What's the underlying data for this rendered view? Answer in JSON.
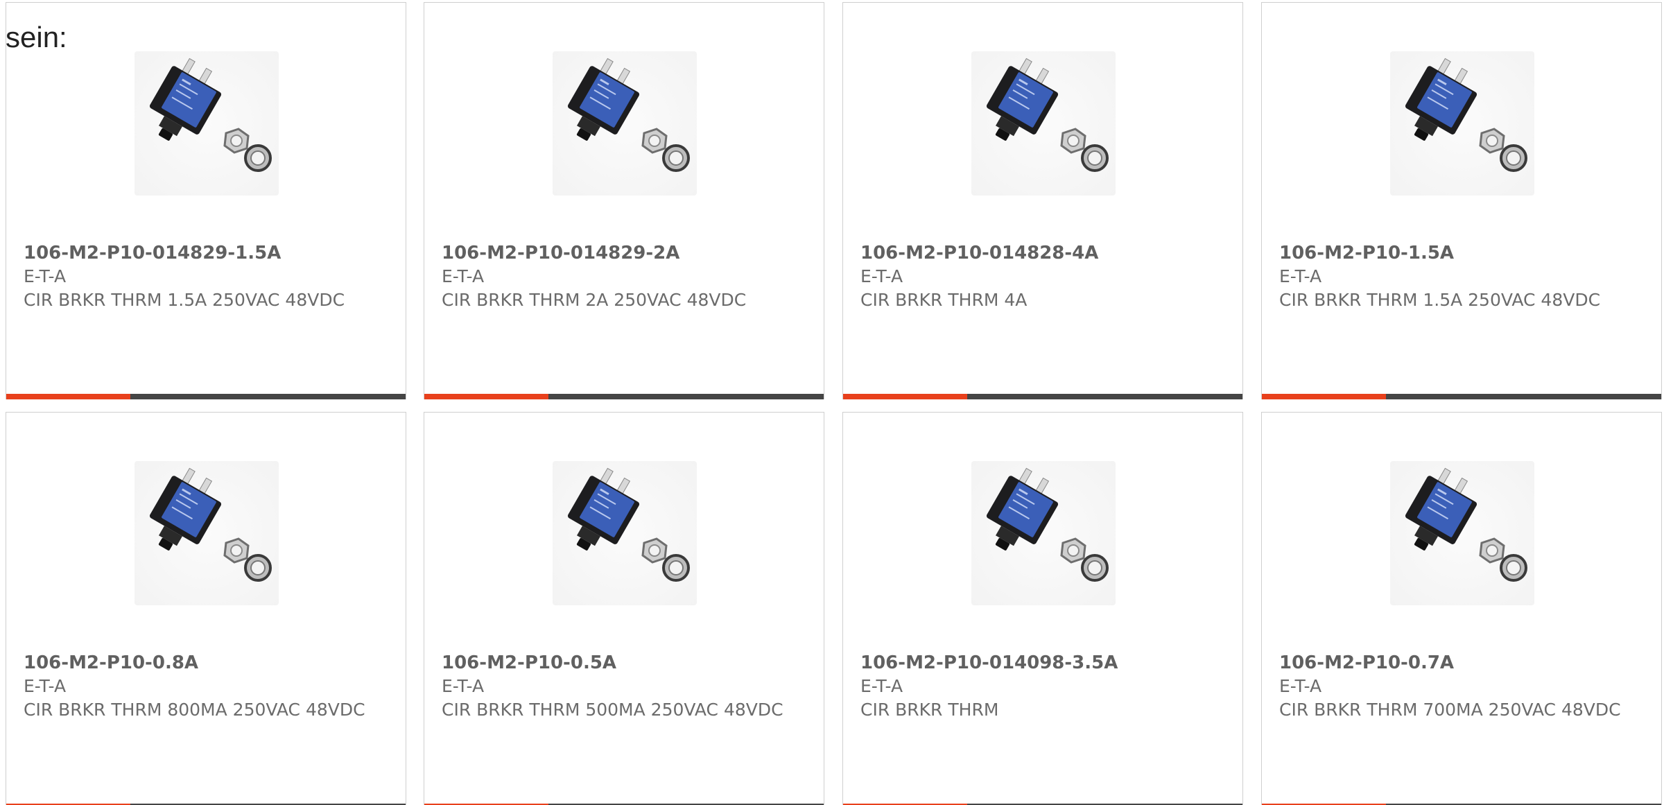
{
  "heading": "sein:",
  "colors": {
    "accent": "#e8401c",
    "bar_track": "#454545",
    "text": "#6b6b6b"
  },
  "cards": [
    {
      "part_number": "106-M2-P10-014829-1.5A",
      "manufacturer": "E-T-A",
      "description": "CIR BRKR THRM 1.5A 250VAC 48VDC",
      "image_icon": "thermal-circuit-breaker-icon"
    },
    {
      "part_number": "106-M2-P10-014829-2A",
      "manufacturer": "E-T-A",
      "description": "CIR BRKR THRM 2A 250VAC 48VDC",
      "image_icon": "thermal-circuit-breaker-icon"
    },
    {
      "part_number": "106-M2-P10-014828-4A",
      "manufacturer": "E-T-A",
      "description": "CIR BRKR THRM 4A",
      "image_icon": "thermal-circuit-breaker-icon"
    },
    {
      "part_number": "106-M2-P10-1.5A",
      "manufacturer": "E-T-A",
      "description": "CIR BRKR THRM 1.5A 250VAC 48VDC",
      "image_icon": "thermal-circuit-breaker-icon"
    },
    {
      "part_number": "106-M2-P10-0.8A",
      "manufacturer": "E-T-A",
      "description": "CIR BRKR THRM 800MA 250VAC 48VDC",
      "image_icon": "thermal-circuit-breaker-icon"
    },
    {
      "part_number": "106-M2-P10-0.5A",
      "manufacturer": "E-T-A",
      "description": "CIR BRKR THRM 500MA 250VAC 48VDC",
      "image_icon": "thermal-circuit-breaker-icon"
    },
    {
      "part_number": "106-M2-P10-014098-3.5A",
      "manufacturer": "E-T-A",
      "description": "CIR BRKR THRM",
      "image_icon": "thermal-circuit-breaker-icon"
    },
    {
      "part_number": "106-M2-P10-0.7A",
      "manufacturer": "E-T-A",
      "description": "CIR BRKR THRM 700MA 250VAC 48VDC",
      "image_icon": "thermal-circuit-breaker-icon"
    }
  ],
  "accent_bar_fraction": 0.31
}
